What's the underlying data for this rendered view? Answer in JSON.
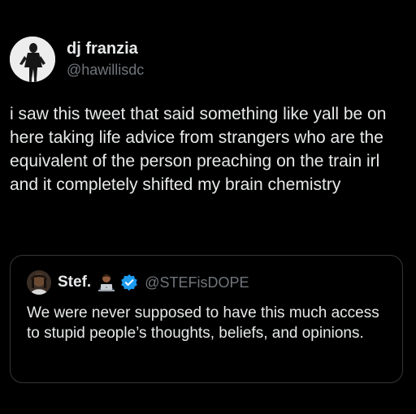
{
  "tweet": {
    "display_name": "dj franzia",
    "handle": "@hawillisdc",
    "text": "i saw this tweet that said something like yall be on here taking life advice from strangers who are the equivalent of the person preaching on the train irl and it completely shifted my brain chemistry"
  },
  "quoted_tweet": {
    "display_name": "Stef.",
    "handle": "@STEFisDOPE",
    "text": "We were never supposed to have this much access to stupid people’s thoughts, beliefs, and opinions.",
    "badges": [
      "technologist-emoji",
      "verified-badge-icon"
    ]
  },
  "colors": {
    "background": "#000000",
    "text_primary": "#e7e9ea",
    "text_secondary": "#71767b",
    "border": "#333639",
    "verified_blue": "#1d9bf0"
  }
}
